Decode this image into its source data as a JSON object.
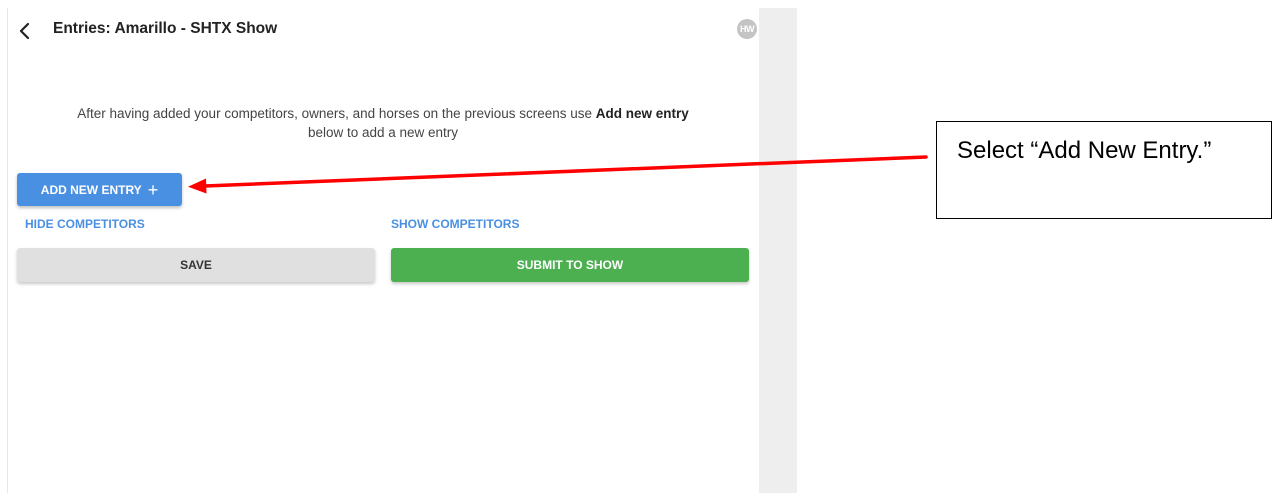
{
  "header": {
    "title": "Entries: Amarillo - SHTX Show",
    "back_icon": "chevron-left-icon",
    "logo_text": "HW"
  },
  "instructions": {
    "text_before": "After having added your competitors, owners, and horses on the previous screens use ",
    "text_bold": "Add new entry",
    "text_after": " below to add a new entry"
  },
  "actions": {
    "add_entry_label": "ADD NEW ENTRY",
    "add_entry_icon": "+",
    "hide_competitors_label": "HIDE COMPETITORS",
    "show_competitors_label": "SHOW COMPETITORS",
    "save_label": "SAVE",
    "submit_label": "SUBMIT TO SHOW"
  },
  "annotation": {
    "callout_text": "Select “Add New Entry.”",
    "arrow_color": "#ff0000"
  },
  "colors": {
    "primary_blue": "#4a90e2",
    "success_green": "#4caf50",
    "neutral_grey": "#e0e0e0"
  }
}
